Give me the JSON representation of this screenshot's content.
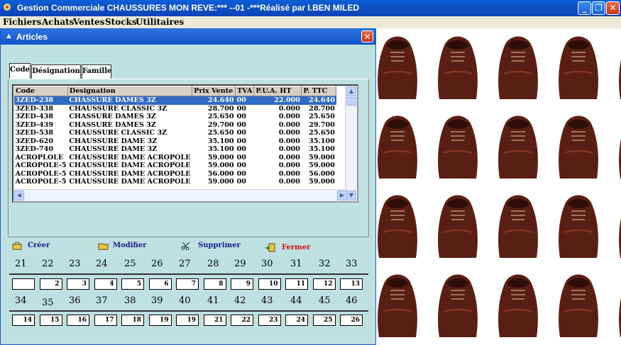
{
  "app": {
    "title": "Gestion Commerciale CHAUSSURES MON REVE:***   --01 -***Réalisé par I.BEN MILED"
  },
  "menu": [
    "Fichiers",
    "Achats",
    "Ventes",
    "Stocks",
    "Utilitaires"
  ],
  "window": {
    "title": "Articles",
    "tabs": [
      "Code",
      "Désignation",
      "Famille"
    ]
  },
  "table": {
    "columns": [
      "Code",
      "Designation",
      "Prix Vente",
      "TVA",
      "P.U.A. HT",
      "P. TTC"
    ],
    "rows": [
      [
        "3ZED-238",
        "CHASSURE DAMES 3Z",
        "24.640",
        "00",
        "22.000",
        "24.640"
      ],
      [
        "3ZED-338",
        "CHAUSSURE CLASSIC 3Z",
        "28.700",
        "00",
        "0.000",
        "28.700"
      ],
      [
        "3ZED-438",
        "CHASSURE DAMES 3Z",
        "25.650",
        "00",
        "0.000",
        "25.650"
      ],
      [
        "3ZED-439",
        "CHASSURE DAMES 3Z",
        "29.700",
        "00",
        "0.000",
        "29.700"
      ],
      [
        "3ZED-538",
        "CHAUSSURE CLASSIC 3Z",
        "25.650",
        "00",
        "0.000",
        "25.650"
      ],
      [
        "3ZED-620",
        "CHAUSSURE DAME 3Z",
        "35.100",
        "00",
        "0.000",
        "35.100"
      ],
      [
        "3ZED-740",
        "CHAUSSURE DAME 3Z",
        "35.100",
        "00",
        "0.000",
        "35.100"
      ],
      [
        "ACROPLOLE",
        "CHAUSSURE DAME ACROPOLE",
        "59.000",
        "00",
        "0.000",
        "59.000"
      ],
      [
        "ACROPOLE-5",
        "CHAUSSURE DAME ACROPOLE",
        "59.000",
        "00",
        "0.000",
        "59.000"
      ],
      [
        "ACROPOLE-5",
        "CHAUSSURE DAME ACROPOLE",
        "56.000",
        "00",
        "0.000",
        "56.000"
      ],
      [
        "ACROPOLE-5",
        "CHAUSSURE DAME ACROPOLE",
        "59.000",
        "00",
        "0.000",
        "59.000"
      ]
    ]
  },
  "actions": {
    "create": "Créer",
    "modify": "Modifier",
    "delete": "Supprimer",
    "close": "Fermer"
  },
  "sizes_row1": [
    "21",
    "22",
    "23",
    "24",
    "25",
    "26",
    "27",
    "28",
    "29",
    "30",
    "31",
    "32",
    "33"
  ],
  "qty_row1": [
    "",
    "2",
    "3",
    "4",
    "5",
    "6",
    "7",
    "8",
    "9",
    "10",
    "11",
    "12",
    "13"
  ],
  "sizes_row2": [
    "34",
    "35",
    "36",
    "37",
    "38",
    "39",
    "40",
    "41",
    "42",
    "43",
    "44",
    "45",
    "46"
  ],
  "qty_row2": [
    "14",
    "15",
    "16",
    "17",
    "18",
    "19",
    "19",
    "21",
    "22",
    "23",
    "24",
    "25",
    "26"
  ],
  "colors": {
    "titlebar": "#0a5fd8",
    "child_bg": "#bfe0e1",
    "selection": "#316ac5",
    "create": "#1a1a8c",
    "modify": "#1a1a8c",
    "delete": "#1a1a8c",
    "close": "#d01010"
  }
}
